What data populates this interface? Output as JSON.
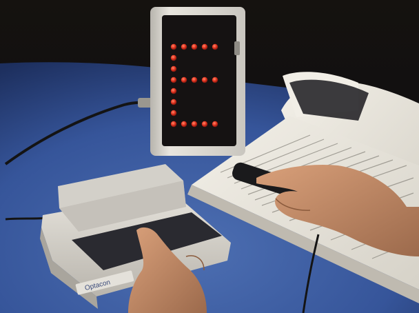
{
  "device": {
    "label_text": "Optacon"
  },
  "display": {
    "letter": "E",
    "dot_color": "#e0321f",
    "dot_glow": "#ff6a4a"
  },
  "colors": {
    "background": "#0b0c12",
    "carpet": "#3a5a9a",
    "carpet_dark": "#22386c",
    "device_body": "#d9d6cf",
    "book_page": "#ece9e0",
    "skin": "#c8906c"
  }
}
